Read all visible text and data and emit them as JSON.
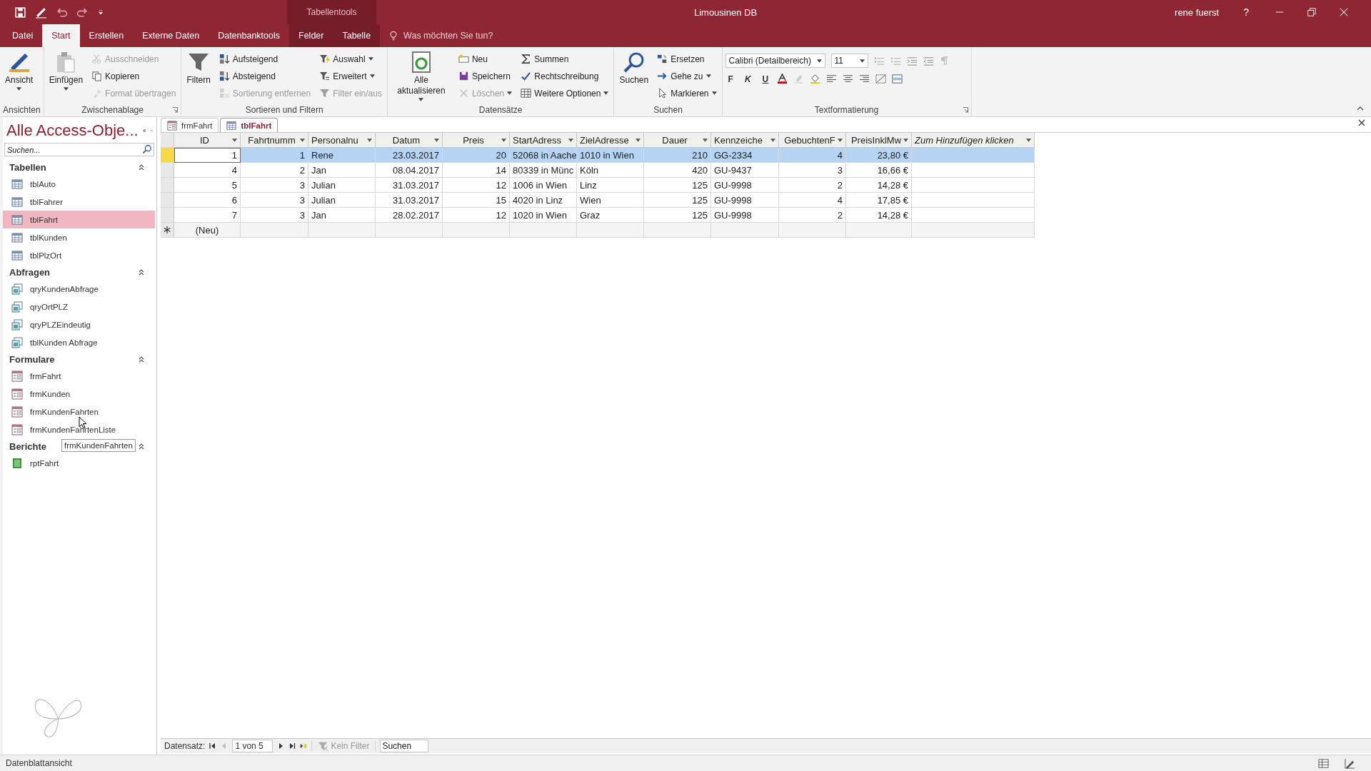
{
  "window": {
    "title": "Limousinen DB",
    "context_group": "Tabellentools",
    "user": "rene fuerst",
    "help": "?"
  },
  "ribbon_tabs": [
    {
      "label": "Datei",
      "selected": false,
      "context": false
    },
    {
      "label": "Start",
      "selected": true,
      "context": false
    },
    {
      "label": "Erstellen",
      "selected": false,
      "context": false
    },
    {
      "label": "Externe Daten",
      "selected": false,
      "context": false
    },
    {
      "label": "Datenbanktools",
      "selected": false,
      "context": false
    },
    {
      "label": "Felder",
      "selected": false,
      "context": true
    },
    {
      "label": "Tabelle",
      "selected": false,
      "context": true
    }
  ],
  "tell_me": {
    "placeholder": "Was möchten Sie tun?"
  },
  "ribbon_groups": [
    {
      "label": "Ansichten",
      "launcher": false,
      "columns": [
        {
          "kind": "large",
          "items": [
            {
              "label": "Ansicht",
              "disabled": false,
              "menu": true
            }
          ]
        }
      ]
    },
    {
      "label": "Zwischenablage",
      "launcher": true,
      "columns": [
        {
          "kind": "large",
          "items": [
            {
              "label": "Einfügen",
              "disabled": false,
              "menu": true
            }
          ]
        },
        {
          "kind": "small",
          "items": [
            {
              "label": "Ausschneiden",
              "disabled": true,
              "menu": false
            },
            {
              "label": "Kopieren",
              "disabled": false,
              "menu": false
            },
            {
              "label": "Format übertragen",
              "disabled": true,
              "menu": false
            }
          ]
        }
      ]
    },
    {
      "label": "Sortieren und Filtern",
      "launcher": false,
      "columns": [
        {
          "kind": "large",
          "items": [
            {
              "label": "Filtern",
              "disabled": false,
              "menu": false
            }
          ]
        },
        {
          "kind": "small",
          "items": [
            {
              "label": "Aufsteigend",
              "disabled": false,
              "menu": false
            },
            {
              "label": "Absteigend",
              "disabled": false,
              "menu": false
            },
            {
              "label": "Sortierung entfernen",
              "disabled": true,
              "menu": false
            }
          ]
        },
        {
          "kind": "small",
          "items": [
            {
              "label": "Auswahl",
              "disabled": false,
              "menu": true
            },
            {
              "label": "Erweitert",
              "disabled": false,
              "menu": true
            },
            {
              "label": "Filter ein/aus",
              "disabled": true,
              "menu": false
            }
          ]
        }
      ]
    },
    {
      "label": "Datensätze",
      "launcher": false,
      "columns": [
        {
          "kind": "large",
          "items": [
            {
              "label": "Alle aktualisieren",
              "disabled": false,
              "menu": true
            }
          ]
        },
        {
          "kind": "small",
          "items": [
            {
              "label": "Neu",
              "disabled": false,
              "menu": false
            },
            {
              "label": "Speichern",
              "disabled": false,
              "menu": false
            },
            {
              "label": "Löschen",
              "disabled": true,
              "menu": true
            }
          ]
        },
        {
          "kind": "small",
          "items": [
            {
              "label": "Summen",
              "disabled": false,
              "menu": false
            },
            {
              "label": "Rechtschreibung",
              "disabled": false,
              "menu": false
            },
            {
              "label": "Weitere Optionen",
              "disabled": false,
              "menu": true
            }
          ]
        }
      ]
    },
    {
      "label": "Suchen",
      "launcher": false,
      "columns": [
        {
          "kind": "large",
          "items": [
            {
              "label": "Suchen",
              "disabled": false,
              "menu": false
            }
          ]
        },
        {
          "kind": "small",
          "items": [
            {
              "label": "Ersetzen",
              "disabled": false,
              "menu": false
            },
            {
              "label": "Gehe zu",
              "disabled": false,
              "menu": true
            },
            {
              "label": "Markieren",
              "disabled": false,
              "menu": true
            }
          ]
        }
      ]
    }
  ],
  "text_format": {
    "label": "Textformatierung",
    "launcher": true,
    "font": "Calibri (Detailbereich)",
    "size": "11",
    "style_buttons": [
      "F",
      "K",
      "U"
    ]
  },
  "nav_pane": {
    "title": "Alle Access-Obje...",
    "search": {
      "placeholder": "Suchen..."
    },
    "sections": [
      {
        "label": "Tabellen",
        "expanded": true,
        "items": [
          {
            "label": "tblAuto",
            "kind": "table",
            "selected": false
          },
          {
            "label": "tblFahrer",
            "kind": "table",
            "selected": false
          },
          {
            "label": "tblFahrt",
            "kind": "table",
            "selected": true
          },
          {
            "label": "tblKunden",
            "kind": "table",
            "selected": false
          },
          {
            "label": "tblPlzOrt",
            "kind": "table",
            "selected": false
          }
        ]
      },
      {
        "label": "Abfragen",
        "expanded": true,
        "items": [
          {
            "label": "qryKundenAbfrage",
            "kind": "query",
            "selected": false
          },
          {
            "label": "qryOrtPLZ",
            "kind": "query",
            "selected": false
          },
          {
            "label": "qryPLZEindeutig",
            "kind": "query",
            "selected": false
          },
          {
            "label": "tblKunden Abfrage",
            "kind": "query",
            "selected": false
          }
        ]
      },
      {
        "label": "Formulare",
        "expanded": true,
        "items": [
          {
            "label": "frmFahrt",
            "kind": "form",
            "selected": false
          },
          {
            "label": "frmKunden",
            "kind": "form",
            "selected": false
          },
          {
            "label": "frmKundenFahrten",
            "kind": "form",
            "selected": false
          },
          {
            "label": "frmKundenFahrtenListe",
            "kind": "form",
            "selected": false
          }
        ]
      },
      {
        "label": "Berichte",
        "expanded": true,
        "items": [
          {
            "label": "rptFahrt",
            "kind": "report",
            "selected": false
          }
        ]
      }
    ],
    "tooltip": "frmKundenFahrten"
  },
  "doc_tabs": [
    {
      "label": "frmFahrt",
      "kind": "form",
      "selected": false
    },
    {
      "label": "tblFahrt",
      "kind": "table",
      "selected": true
    }
  ],
  "table": {
    "columns": [
      {
        "label": "ID",
        "kind": "number"
      },
      {
        "label": "Fahrtnumm",
        "kind": "number"
      },
      {
        "label": "Personalnu",
        "kind": "text"
      },
      {
        "label": "Datum",
        "kind": "number"
      },
      {
        "label": "Preis",
        "kind": "number"
      },
      {
        "label": "StartAdress",
        "kind": "text"
      },
      {
        "label": "ZielAdresse",
        "kind": "text"
      },
      {
        "label": "Dauer",
        "kind": "number"
      },
      {
        "label": "Kennzeiche",
        "kind": "text"
      },
      {
        "label": "GebuchtenF",
        "kind": "number"
      },
      {
        "label": "PreisInklMw",
        "kind": "number"
      },
      {
        "label": "Zum Hinzufügen klicken",
        "kind": "add"
      }
    ],
    "rows": [
      {
        "selected": true,
        "current": true,
        "cells": [
          "1",
          "1",
          "Rene",
          "23.03.2017",
          "20",
          "52068 in Aache",
          "1010 in Wien",
          "210",
          "GG-2334",
          "4",
          "23,80 €",
          ""
        ]
      },
      {
        "selected": false,
        "current": false,
        "cells": [
          "4",
          "2",
          "Jan",
          "08.04.2017",
          "14",
          "80339 in Münc",
          "Köln",
          "420",
          "GU-9437",
          "3",
          "16,66 €",
          ""
        ]
      },
      {
        "selected": false,
        "current": false,
        "cells": [
          "5",
          "3",
          "Julian",
          "31.03.2017",
          "12",
          "1006 in Wien",
          "Linz",
          "125",
          "GU-9998",
          "2",
          "14,28 €",
          ""
        ]
      },
      {
        "selected": false,
        "current": false,
        "cells": [
          "6",
          "3",
          "Julian",
          "31.03.2017",
          "15",
          "4020 in Linz",
          "Wien",
          "125",
          "GU-9998",
          "4",
          "17,85 €",
          ""
        ]
      },
      {
        "selected": false,
        "current": false,
        "cells": [
          "7",
          "3",
          "Jan",
          "28.02.2017",
          "12",
          "1020 in Wien",
          "Graz",
          "125",
          "GU-9998",
          "2",
          "14,28 €",
          ""
        ]
      }
    ],
    "new_row": "(Neu)"
  },
  "record_nav": {
    "label": "Datensatz:",
    "position": "1 von 5",
    "filter": "Kein Filter",
    "search": {
      "placeholder": "Suchen"
    }
  },
  "status_bar": {
    "text": "Datenblattansicht"
  }
}
